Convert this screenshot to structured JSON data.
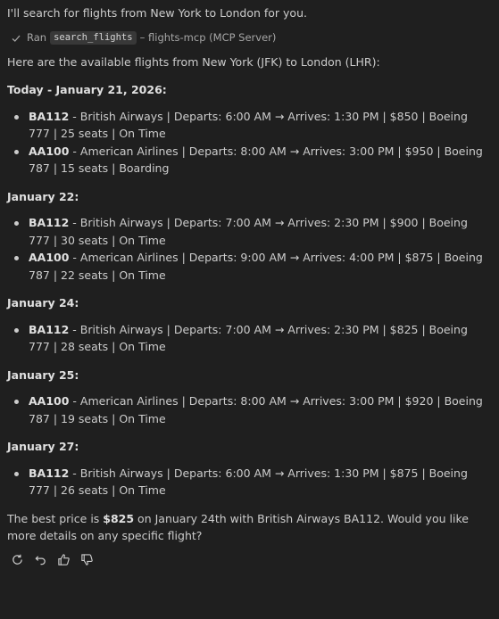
{
  "intro": "I'll search for flights from New York to London for you.",
  "tool": {
    "prefix": "Ran",
    "name": "search_flights",
    "suffix": "– flights-mcp (MCP Server)"
  },
  "lead": "Here are the available flights from New York (JFK) to London (LHR):",
  "days": [
    {
      "heading": "Today - January 21, 2026:",
      "flights": [
        {
          "code": "BA112",
          "details": " - British Airways | Departs: 6:00 AM → Arrives: 1:30 PM | $850 | Boeing 777 | 25 seats | On Time"
        },
        {
          "code": "AA100",
          "details": " - American Airlines | Departs: 8:00 AM → Arrives: 3:00 PM | $950 | Boeing 787 | 15 seats | Boarding"
        }
      ]
    },
    {
      "heading": "January 22:",
      "flights": [
        {
          "code": "BA112",
          "details": " - British Airways | Departs: 7:00 AM → Arrives: 2:30 PM | $900 | Boeing 777 | 30 seats | On Time"
        },
        {
          "code": "AA100",
          "details": " - American Airlines | Departs: 9:00 AM → Arrives: 4:00 PM | $875 | Boeing 787 | 22 seats | On Time"
        }
      ]
    },
    {
      "heading": "January 24:",
      "flights": [
        {
          "code": "BA112",
          "details": " - British Airways | Departs: 7:00 AM → Arrives: 2:30 PM | $825 | Boeing 777 | 28 seats | On Time"
        }
      ]
    },
    {
      "heading": "January 25:",
      "flights": [
        {
          "code": "AA100",
          "details": " - American Airlines | Departs: 8:00 AM → Arrives: 3:00 PM | $920 | Boeing 787 | 19 seats | On Time"
        }
      ]
    },
    {
      "heading": "January 27:",
      "flights": [
        {
          "code": "BA112",
          "details": " - British Airways | Departs: 6:00 AM → Arrives: 1:30 PM | $875 | Boeing 777 | 26 seats | On Time"
        }
      ]
    }
  ],
  "summary": {
    "before": "The best price is ",
    "price": "$825",
    "after": " on January 24th with British Airways BA112. Would you like more details on any specific flight?"
  },
  "actions": [
    {
      "name": "retry-icon"
    },
    {
      "name": "undo-icon"
    },
    {
      "name": "thumbs-up-icon"
    },
    {
      "name": "thumbs-down-icon"
    }
  ],
  "colors": {
    "background": "#1f1f1f",
    "text": "#cccccc",
    "muted": "#a6a6a6",
    "code_bg": "#383838"
  }
}
